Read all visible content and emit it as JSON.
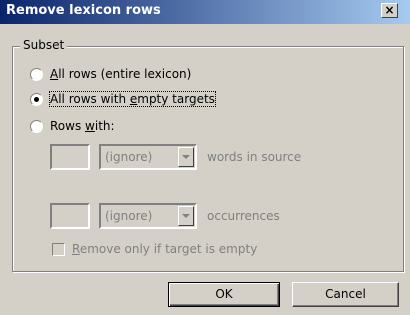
{
  "window": {
    "title": "Remove lexicon rows",
    "close_glyph": "×"
  },
  "subset": {
    "legend": "Subset",
    "options": [
      {
        "label_pre": "",
        "label_key": "A",
        "label_post": "ll rows (entire lexicon)",
        "checked": false
      },
      {
        "label_pre": "All rows with ",
        "label_key": "e",
        "label_post": "mpty targets",
        "checked": true
      },
      {
        "label_pre": "Rows ",
        "label_key": "w",
        "label_post": "ith:",
        "checked": false
      }
    ],
    "filter1": {
      "value": "",
      "select": "(ignore)",
      "suffix": "words in source"
    },
    "filter2": {
      "value": "",
      "select": "(ignore)",
      "suffix": "occurrences"
    },
    "checkbox": {
      "label_key": "R",
      "label_post": "emove only if target is empty",
      "checked": false
    }
  },
  "buttons": {
    "ok": "OK",
    "cancel": "Cancel"
  }
}
